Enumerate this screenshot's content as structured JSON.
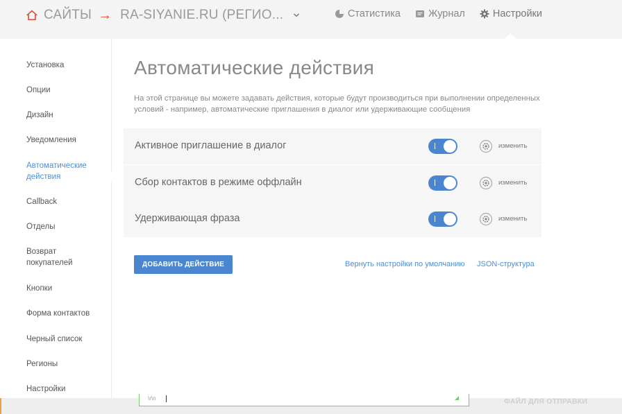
{
  "header": {
    "brand": "САЙТЫ",
    "arrow": "→",
    "site": "RA-SIYANIE.RU (РЕГИО...",
    "nav": [
      {
        "label": "Статистика",
        "icon": "pie-chart-icon"
      },
      {
        "label": "Журнал",
        "icon": "chat-icon"
      },
      {
        "label": "Настройки",
        "icon": "gear-icon"
      }
    ]
  },
  "sidebar": {
    "items": [
      {
        "label": "Установка"
      },
      {
        "label": "Опции"
      },
      {
        "label": "Дизайн"
      },
      {
        "label": "Уведомления"
      },
      {
        "label": "Автоматические действия",
        "active": true
      },
      {
        "label": "Callback"
      },
      {
        "label": "Отделы"
      },
      {
        "label": "Возврат покупателей"
      },
      {
        "label": "Кнопки"
      },
      {
        "label": "Форма контактов"
      },
      {
        "label": "Черный список"
      },
      {
        "label": "Регионы"
      },
      {
        "label": "Настройки"
      }
    ]
  },
  "main": {
    "title": "Автоматические действия",
    "description": "На этой странице вы можете задавать действия, которые будут производиться при выполнении определенных условий - например, автоматические приглашения в диалог или удерживающие сообщения",
    "actions": [
      {
        "label": "Активное приглашение в диалог",
        "enabled": true,
        "edit_label": "изменить"
      },
      {
        "label": "Сбор контактов в режиме оффлайн",
        "enabled": true,
        "edit_label": "изменить"
      },
      {
        "label": "Удерживающая фраза",
        "enabled": true,
        "edit_label": "изменить"
      }
    ],
    "add_button": "ДОБАВИТЬ ДЕЙСТВИЕ",
    "reset_link": "Вернуть настройки по умолчанию",
    "json_link": "JSON-структура"
  },
  "bottom": {
    "input_value": "\\r\\n",
    "file_button": "ФАЙЛ ДЛЯ ОТПРАВКИ"
  },
  "colors": {
    "accent": "#4a86cf",
    "link": "#4a8fd6",
    "arrow": "#e24b3b"
  }
}
